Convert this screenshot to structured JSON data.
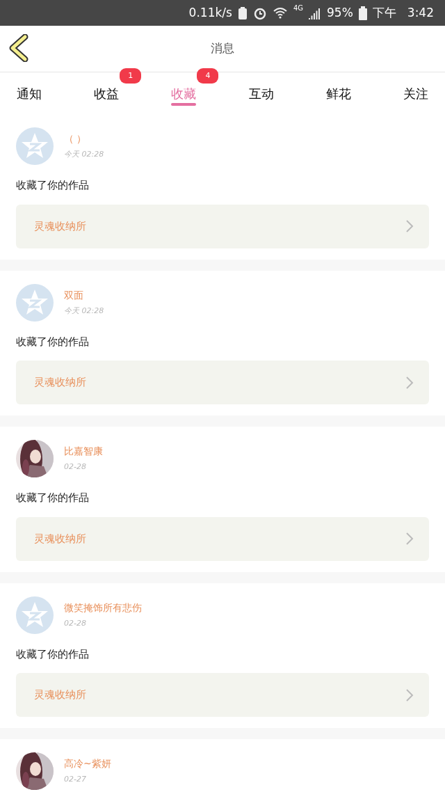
{
  "status_bar": {
    "speed": "0.11k/s",
    "network": "4G",
    "battery": "95%",
    "period": "下午",
    "time": "3:42"
  },
  "header": {
    "title": "消息"
  },
  "tabs": [
    {
      "label": "通知",
      "selected": false
    },
    {
      "label": "收益",
      "selected": false,
      "badge": "1"
    },
    {
      "label": "收藏",
      "selected": true,
      "badge": "4"
    },
    {
      "label": "互动",
      "selected": false
    },
    {
      "label": "鲜花",
      "selected": false
    },
    {
      "label": "关注",
      "selected": false
    }
  ],
  "messages": [
    {
      "avatar": {
        "kind": "default"
      },
      "name": "（ ）",
      "time": "今天 02:28",
      "text": "收藏了你的作品",
      "work": "灵魂收纳所"
    },
    {
      "avatar": {
        "kind": "default"
      },
      "name": "双面",
      "time": "今天 02:28",
      "text": "收藏了你的作品",
      "work": "灵魂收纳所"
    },
    {
      "name": "比嘉智康",
      "time": "02-28",
      "text": "收藏了你的作品",
      "work": "灵魂收纳所"
    },
    {
      "avatar": {
        "kind": "default"
      },
      "name": "微笑掩饰所有悲伤",
      "time": "02-28",
      "text": "收藏了你的作品",
      "work": "灵魂收纳所"
    },
    {
      "name": "高冷~紫妍",
      "time": "02-27"
    }
  ]
}
